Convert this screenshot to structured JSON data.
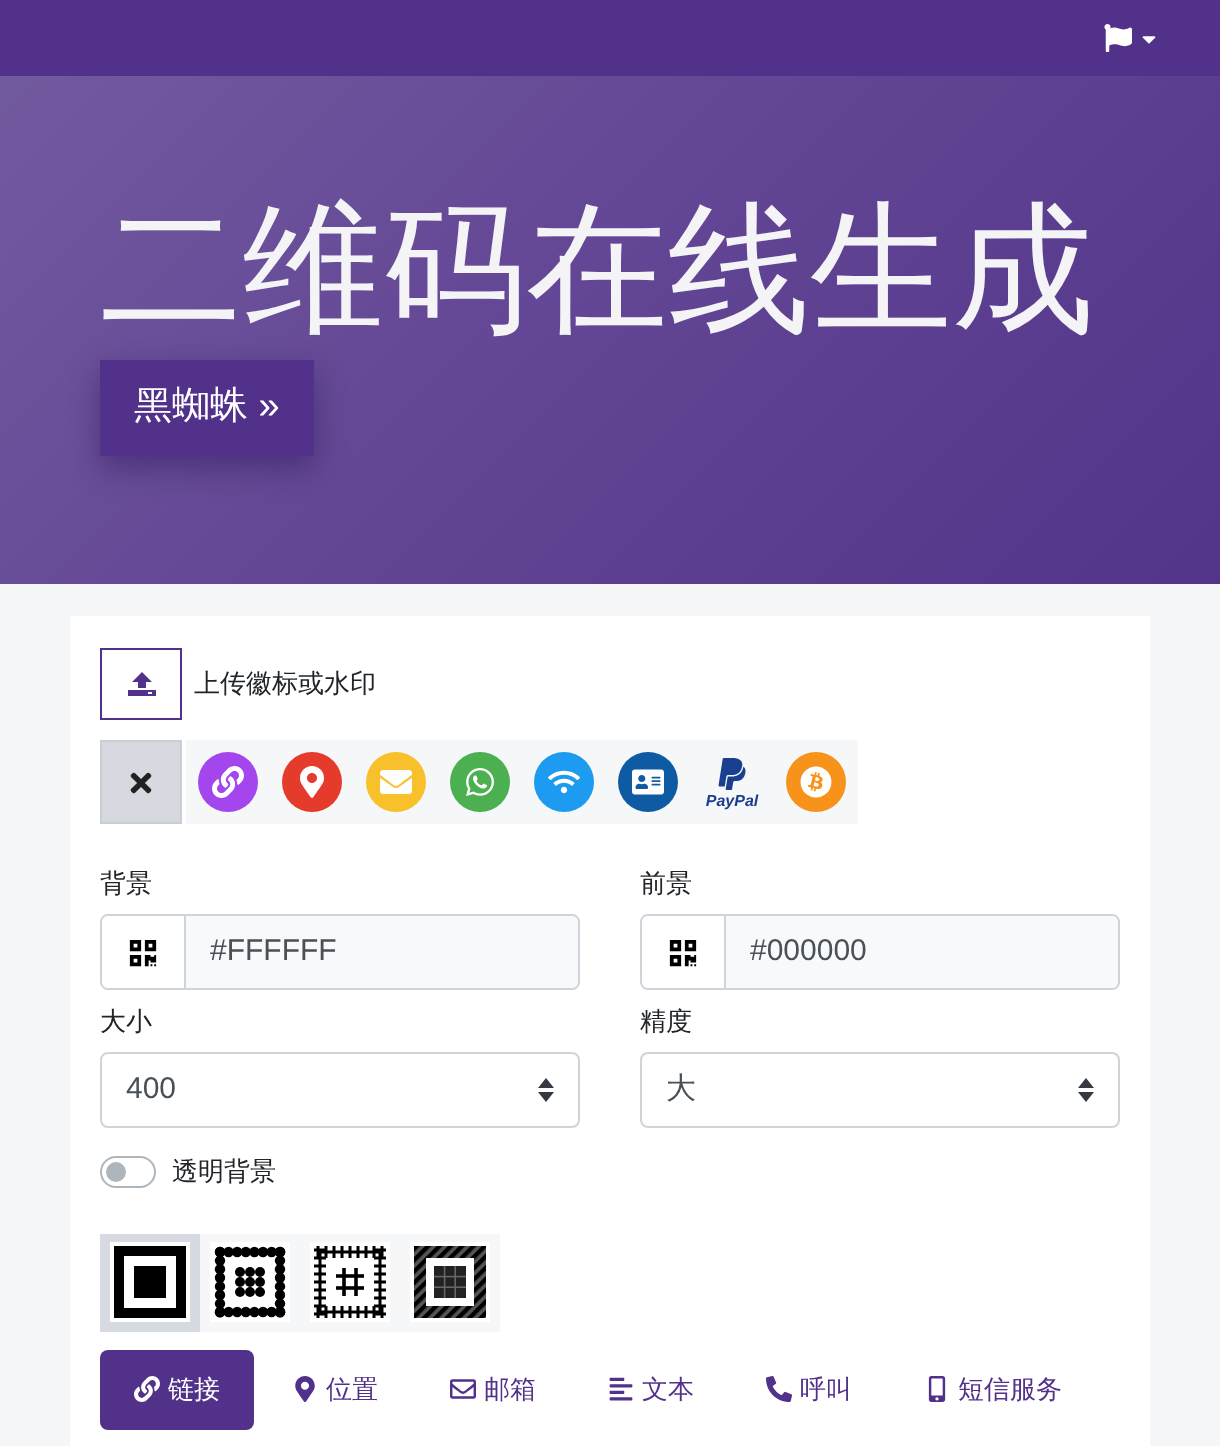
{
  "hero": {
    "title": "二维码在线生成",
    "button": "黑蜘蛛 »"
  },
  "upload": {
    "label": "上传徽标或水印"
  },
  "logos": [
    {
      "kind": "none",
      "selected": true
    },
    {
      "kind": "link",
      "selected": false
    },
    {
      "kind": "location",
      "selected": false
    },
    {
      "kind": "email",
      "selected": false
    },
    {
      "kind": "whatsapp",
      "selected": false
    },
    {
      "kind": "wifi",
      "selected": false
    },
    {
      "kind": "vcard",
      "selected": false
    },
    {
      "kind": "paypal",
      "selected": false,
      "caption": "PayPal"
    },
    {
      "kind": "bitcoin",
      "selected": false
    }
  ],
  "fields": [
    {
      "label": "背景",
      "kind": "color",
      "value": "#FFFFFF"
    },
    {
      "label": "前景",
      "kind": "color",
      "value": "#000000"
    },
    {
      "label": "大小",
      "kind": "select",
      "value": "400"
    },
    {
      "label": "精度",
      "kind": "select",
      "value": "大"
    }
  ],
  "transparent_background": {
    "label": "透明背景",
    "on": false
  },
  "eye_styles": [
    {
      "kind": "square",
      "selected": true
    },
    {
      "kind": "dots",
      "selected": false
    },
    {
      "kind": "grid",
      "selected": false
    },
    {
      "kind": "striped",
      "selected": false
    }
  ],
  "tabs": [
    {
      "label": "链接",
      "kind": "link",
      "selected": true
    },
    {
      "label": "位置",
      "kind": "location",
      "selected": false
    },
    {
      "label": "邮箱",
      "kind": "email",
      "selected": false
    },
    {
      "label": "文本",
      "kind": "text",
      "selected": false
    },
    {
      "label": "呼叫",
      "kind": "call",
      "selected": false
    },
    {
      "label": "短信服务",
      "kind": "sms",
      "selected": false
    }
  ]
}
